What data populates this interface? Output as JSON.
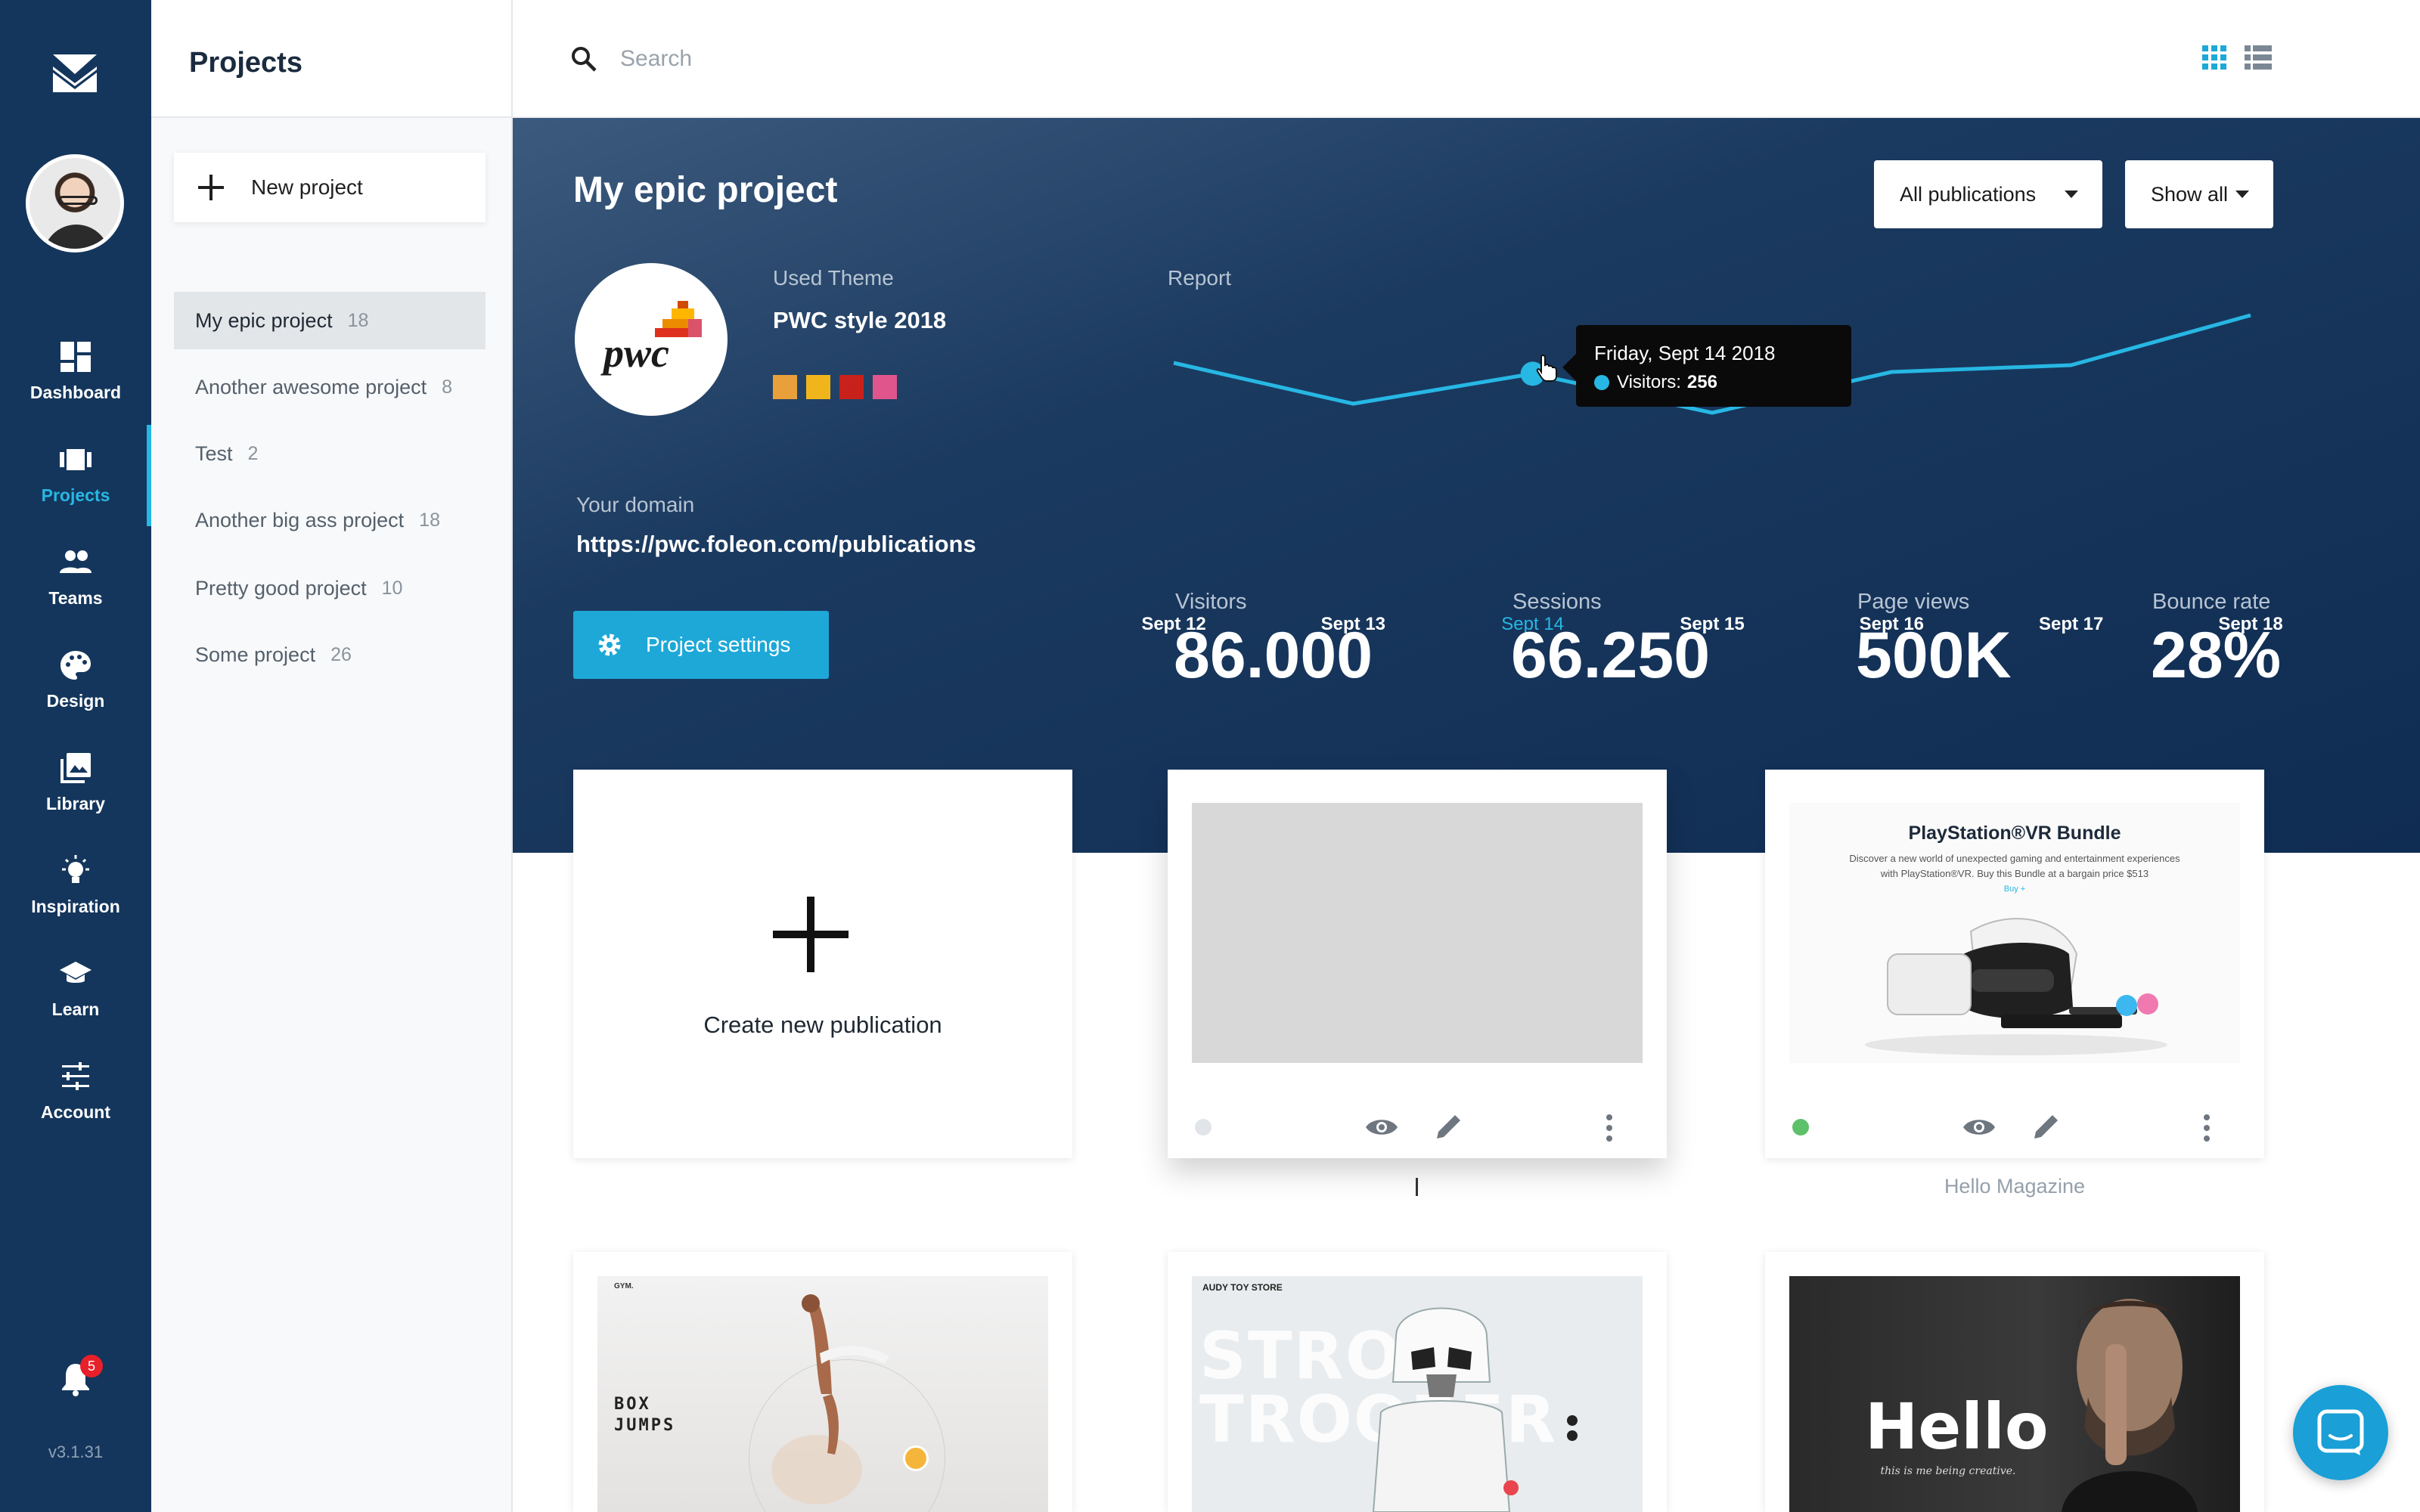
{
  "app": {
    "version": "v3.1.31",
    "notification_count": "5",
    "colors": {
      "nav_bg": "#14365c",
      "accent": "#27b7e3",
      "hero_bg": "#0f2c52",
      "button": "#1ea8d8",
      "badge": "#e8202a"
    }
  },
  "nav": {
    "items": [
      {
        "label": "Dashboard",
        "icon": "dashboard-icon"
      },
      {
        "label": "Projects",
        "icon": "projects-icon",
        "active": true
      },
      {
        "label": "Teams",
        "icon": "teams-icon"
      },
      {
        "label": "Design",
        "icon": "palette-icon"
      },
      {
        "label": "Library",
        "icon": "library-icon"
      },
      {
        "label": "Inspiration",
        "icon": "lightbulb-icon"
      },
      {
        "label": "Learn",
        "icon": "graduation-cap-icon"
      },
      {
        "label": "Account",
        "icon": "sliders-icon"
      }
    ]
  },
  "projects": {
    "title": "Projects",
    "new_label": "New project",
    "items": [
      {
        "name": "My epic project",
        "count": "18",
        "active": true
      },
      {
        "name": "Another awesome project",
        "count": "8"
      },
      {
        "name": "Test",
        "count": "2"
      },
      {
        "name": "Another big ass project",
        "count": "18"
      },
      {
        "name": "Pretty good project",
        "count": "10"
      },
      {
        "name": "Some project",
        "count": "26"
      }
    ]
  },
  "search": {
    "placeholder": "Search",
    "value": ""
  },
  "hero": {
    "title": "My epic project",
    "filter_publications": "All publications",
    "filter_show": "Show all",
    "theme_label": "Used Theme",
    "theme_name": "PWC style 2018",
    "theme_colors": [
      "#e9a03b",
      "#f1b51c",
      "#c8211b",
      "#e0568c"
    ],
    "logo_text": "pwc",
    "domain_label": "Your domain",
    "domain_value": "https://pwc.foleon.com/publications",
    "settings_label": "Project settings",
    "report_label": "Report"
  },
  "tooltip": {
    "date": "Friday, Sept 14 2018",
    "label": "Visitors:",
    "value": "256"
  },
  "stats": [
    {
      "label": "Visitors",
      "value": "86.000"
    },
    {
      "label": "Sessions",
      "value": "66.250"
    },
    {
      "label": "Page views",
      "value": "500K"
    },
    {
      "label": "Bounce rate",
      "value": "28%"
    }
  ],
  "chart_data": {
    "type": "line",
    "title": "Report",
    "categories": [
      "Sept 12",
      "Sept 13",
      "Sept 14",
      "Sept 15",
      "Sept 16",
      "Sept 17",
      "Sept 18"
    ],
    "highlight_index": 2,
    "series": [
      {
        "name": "Visitors",
        "values": [
          280,
          190,
          256,
          170,
          260,
          275,
          385
        ],
        "color": "#27b7e3"
      }
    ],
    "ylim": [
      120,
      420
    ],
    "grid": false
  },
  "cards": {
    "create_label": "Create new publication",
    "items": [
      {
        "status_color": "#e1e4e8",
        "caption": ""
      },
      {
        "status_color": "#5dc16a",
        "caption": "Hello Magazine",
        "thumb_title": "PlayStation®VR Bundle",
        "thumb_text_1": "Discover a new world of unexpected gaming and entertainment experiences",
        "thumb_text_2": "with PlayStation®VR. Buy this Bundle at a bargain price $513",
        "thumb_link": "Buy +"
      },
      {
        "thumb_text_1": "BOX",
        "thumb_text_2": "JUMPS",
        "thumb_brand": "GYM."
      },
      {
        "thumb_text_1": "STROM",
        "thumb_text_2": "TROOPER",
        "thumb_brand": "AUDY TOY STORE"
      },
      {
        "thumb_text_1": "Hello",
        "thumb_text_2": "this is me being creative."
      }
    ]
  }
}
